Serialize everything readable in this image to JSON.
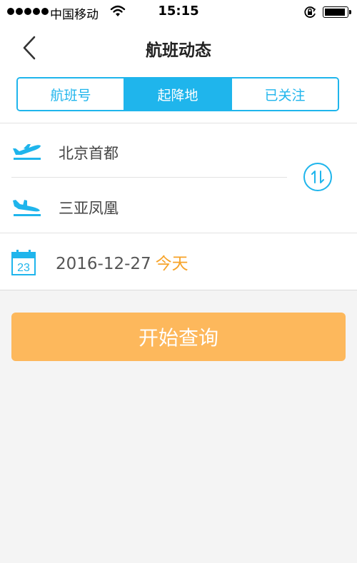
{
  "status_bar": {
    "carrier": "中国移动",
    "time": "15:15",
    "signal_bars": 5,
    "battery_level": 0.95,
    "icons": [
      "signal-icon",
      "wifi-icon",
      "rotation-lock-icon",
      "battery-icon"
    ]
  },
  "nav": {
    "title": "航班动态",
    "back_icon": "chevron-left-icon"
  },
  "tabs": [
    {
      "label": "航班号",
      "active": false
    },
    {
      "label": "起降地",
      "active": true
    },
    {
      "label": "已关注",
      "active": false
    }
  ],
  "form": {
    "departure": {
      "value": "北京首都",
      "icon": "plane-takeoff-icon"
    },
    "arrival": {
      "value": "三亚凤凰",
      "icon": "plane-landing-icon"
    },
    "swap_icon": "swap-arrows-icon",
    "date": {
      "value": "2016-12-27",
      "relative": "今天",
      "icon": "calendar-icon",
      "icon_day": "23"
    }
  },
  "search_button": {
    "label": "开始查询"
  },
  "colors": {
    "accent": "#1fb5ec",
    "highlight": "#f7a328",
    "button": "#fdb85c",
    "background": "#f4f4f4"
  }
}
